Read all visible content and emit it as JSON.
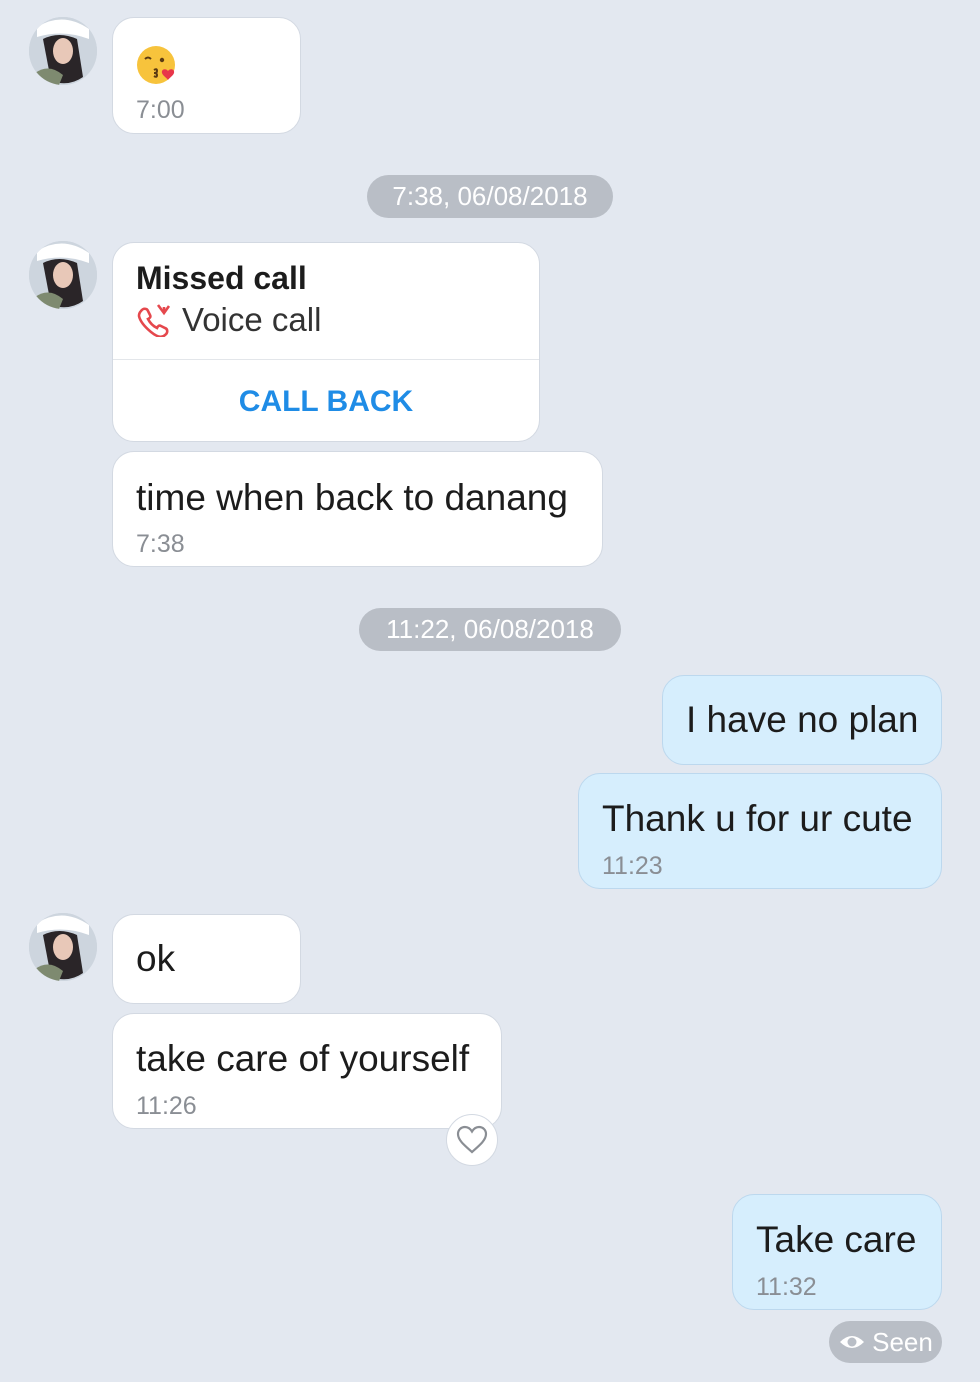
{
  "conversation": {
    "messages": [
      {
        "type": "emoji",
        "emoji": "kissing-face-with-heart",
        "time": "7:00"
      },
      {
        "type": "date_divider",
        "text": "7:38, 06/08/2018"
      },
      {
        "type": "missed_call",
        "title": "Missed call",
        "subtitle": "Voice call",
        "action": "CALL BACK"
      },
      {
        "type": "text",
        "direction": "in",
        "text": "time when back to danang",
        "time": "7:38"
      },
      {
        "type": "date_divider",
        "text": "11:22, 06/08/2018"
      },
      {
        "type": "text",
        "direction": "out",
        "text": "I have no plan"
      },
      {
        "type": "text",
        "direction": "out",
        "text": "Thank u for ur cute",
        "time": "11:23"
      },
      {
        "type": "text",
        "direction": "in",
        "text": "ok"
      },
      {
        "type": "text",
        "direction": "in",
        "text": "take care of yourself",
        "time": "11:26"
      },
      {
        "type": "text",
        "direction": "out",
        "text": "Take care",
        "time": "11:32"
      }
    ],
    "seen_label": "Seen"
  },
  "icons": {
    "reaction": "heart-outline-icon",
    "missed_call": "missed-call-icon",
    "seen": "eye-icon"
  },
  "colors": {
    "background": "#e3e8f0",
    "incoming_bubble": "#ffffff",
    "outgoing_bubble": "#d6eefd",
    "call_back": "#1f8ce6",
    "missed_call_icon": "#e5484d",
    "date_pill": "#b9bec6"
  }
}
